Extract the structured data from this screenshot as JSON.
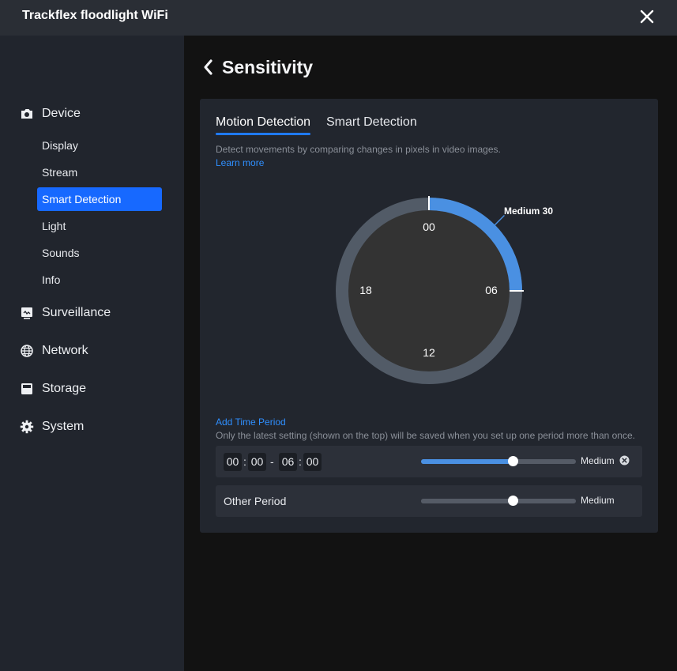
{
  "window": {
    "title": "Trackflex floodlight WiFi",
    "close_icon": "close-icon"
  },
  "sidebar": {
    "groups": [
      {
        "label": "Device",
        "icon": "camera-icon"
      },
      {
        "label": "Surveillance",
        "icon": "monitor-icon"
      },
      {
        "label": "Network",
        "icon": "globe-icon"
      },
      {
        "label": "Storage",
        "icon": "storage-icon"
      },
      {
        "label": "System",
        "icon": "gear-icon"
      }
    ],
    "device_items": [
      {
        "label": "Display"
      },
      {
        "label": "Stream"
      },
      {
        "label": "Smart Detection",
        "active": true
      },
      {
        "label": "Light"
      },
      {
        "label": "Sounds"
      },
      {
        "label": "Info"
      }
    ]
  },
  "page": {
    "title": "Sensitivity",
    "back_icon": "chevron-left-icon"
  },
  "tabs": [
    {
      "label": "Motion Detection",
      "active": true
    },
    {
      "label": "Smart Detection",
      "active": false
    }
  ],
  "description": "Detect movements by comparing changes in pixels in video images.",
  "learn_more": "Learn more",
  "dial": {
    "labels": {
      "top": "00",
      "right": "06",
      "bottom": "12",
      "left": "18"
    },
    "period_label": "Medium 30",
    "period_start_hour": 0,
    "period_end_hour": 6,
    "active_color": "#4a90e2",
    "ring_color": "#525b67"
  },
  "add_time_period": "Add Time Period",
  "note": "Only the latest setting (shown on the top) will be saved when you set up one period more than once.",
  "periods": [
    {
      "start_h": "00",
      "start_m": "00",
      "separator": "-",
      "end_h": "06",
      "end_m": "00",
      "level_label": "Medium",
      "slider_fraction": 0.59,
      "remove_icon": "remove-circle-icon"
    }
  ],
  "other_period": {
    "label": "Other Period",
    "level_label": "Medium",
    "slider_fraction": 0.59
  },
  "colors": {
    "accent": "#1769ff",
    "link": "#2f8fff"
  }
}
